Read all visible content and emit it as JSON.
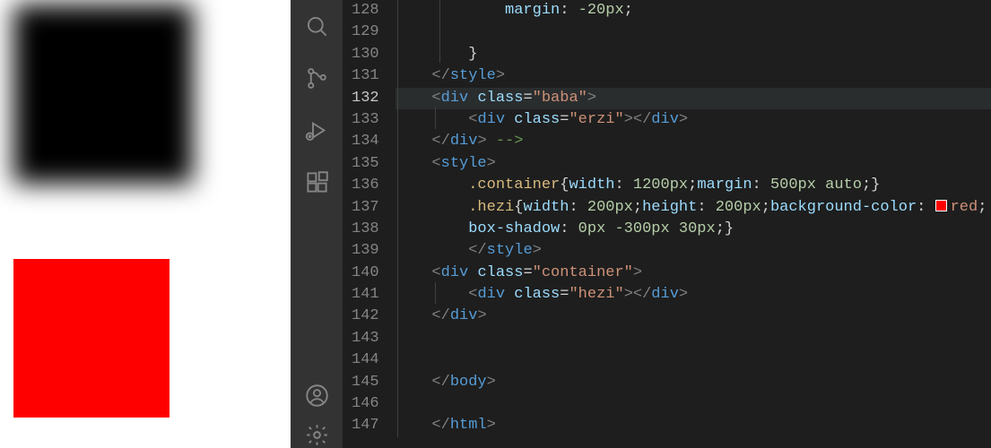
{
  "lines": {
    "128": "128",
    "129": "129",
    "130": "130",
    "131": "131",
    "132": "132",
    "133": "133",
    "134": "134",
    "135": "135",
    "136": "136",
    "137": "137",
    "138": "138",
    "139": "139",
    "140": "140",
    "141": "141",
    "142": "142",
    "143": "143",
    "144": "144",
    "145": "145",
    "146": "146",
    "147": "147"
  },
  "code": {
    "l128_indent": "            ",
    "l128_prop": "margin",
    "l128_colon": ": ",
    "l128_val": "-20px",
    "l128_semi": ";",
    "l130_indent": "        ",
    "l130_text": "}",
    "l131_indent": "    ",
    "l131_o": "</",
    "l131_name": "style",
    "l131_c": ">",
    "l132_indent": "    ",
    "l132_o": "<",
    "l132_name": "div",
    "l132_sp": " ",
    "l132_attr": "class",
    "l132_eq": "=",
    "l132_str": "\"baba\"",
    "l132_c": ">",
    "l133_indent": "        ",
    "l133_o": "<",
    "l133_name": "div",
    "l133_sp": " ",
    "l133_attr": "class",
    "l133_eq": "=",
    "l133_str": "\"erzi\"",
    "l133_c": ">",
    "l133_o2": "</",
    "l133_name2": "div",
    "l133_c2": ">",
    "l134_indent": "    ",
    "l134_o": "</",
    "l134_name": "div",
    "l134_c": ">",
    "l134_com": " -->",
    "l135_indent": "    ",
    "l135_o": "<",
    "l135_name": "style",
    "l135_c": ">",
    "l136_indent": "        ",
    "l136_sel": ".container",
    "l136_b": "{",
    "l136_p1": "width",
    "l136_c1": ": ",
    "l136_v1": "1200px",
    "l136_s1": ";",
    "l136_p2": "margin",
    "l136_c2": ": ",
    "l136_v2": "500px",
    "l136_sp2": " ",
    "l136_v2b": "auto",
    "l136_s2": ";",
    "l136_e": "}",
    "l137_indent": "        ",
    "l137_sel": ".hezi",
    "l137_b": "{",
    "l137_p1": "width",
    "l137_c1": ": ",
    "l137_v1": "200px",
    "l137_s1": ";",
    "l137_p2": "height",
    "l137_c2": ": ",
    "l137_v2": "200px",
    "l137_s2": ";",
    "l137_p3": "background-color",
    "l137_c3": ": ",
    "l137_swatch": "#ff0000",
    "l137_v3": "red",
    "l137_s3": ";",
    "l138_indent": "        ",
    "l138_p": "box-shadow",
    "l138_c": ": ",
    "l138_v1": "0px",
    "l138_sp1": " ",
    "l138_v2": "-300px",
    "l138_sp2": " ",
    "l138_v3": "30px",
    "l138_s": ";",
    "l138_e": "}",
    "l139_indent": "        ",
    "l139_o": "</",
    "l139_name": "style",
    "l139_c": ">",
    "l140_indent": "    ",
    "l140_o": "<",
    "l140_name": "div",
    "l140_sp": " ",
    "l140_attr": "class",
    "l140_eq": "=",
    "l140_str": "\"container\"",
    "l140_c": ">",
    "l141_indent": "        ",
    "l141_o": "<",
    "l141_name": "div",
    "l141_sp": " ",
    "l141_attr": "class",
    "l141_eq": "=",
    "l141_str": "\"hezi\"",
    "l141_c": ">",
    "l141_o2": "</",
    "l141_name2": "div",
    "l141_c2": ">",
    "l142_indent": "    ",
    "l142_o": "</",
    "l142_name": "div",
    "l142_c": ">",
    "l145_indent": "    ",
    "l145_o": "</",
    "l145_name": "body",
    "l145_c": ">",
    "l147_indent": "    ",
    "l147_o": "</",
    "l147_name": "html",
    "l147_c": ">"
  }
}
